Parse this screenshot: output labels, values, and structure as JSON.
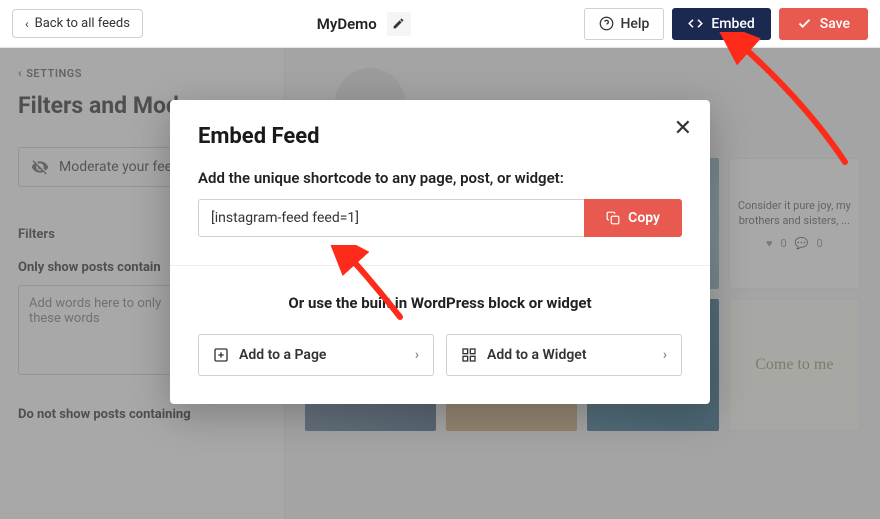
{
  "topbar": {
    "back_label": "Back to all feeds",
    "title": "MyDemo",
    "help_label": "Help",
    "embed_label": "Embed",
    "save_label": "Save"
  },
  "sidebar": {
    "settings_label": "SETTINGS",
    "heading": "Filters and Mod",
    "moderate_label": "Moderate your fee",
    "filters_section": "Filters",
    "only_show_label": "Only show posts contain",
    "only_show_placeholder": "Add words here to only\nthese words",
    "not_show_label": "Do not show posts containing"
  },
  "preview": {
    "tile4_caption": "Consider it pure joy, my brothers and sisters, ...",
    "tile4_likes": "0",
    "tile4_comments": "0",
    "tile8_text": "Come to me"
  },
  "modal": {
    "title": "Embed Feed",
    "subtitle": "Add the unique shortcode to any page, post, or widget:",
    "shortcode": "[instagram-feed feed=1]",
    "copy_label": "Copy",
    "or_text": "Or use the built in WordPress block or widget",
    "add_page_label": "Add to a Page",
    "add_widget_label": "Add to a Widget"
  }
}
